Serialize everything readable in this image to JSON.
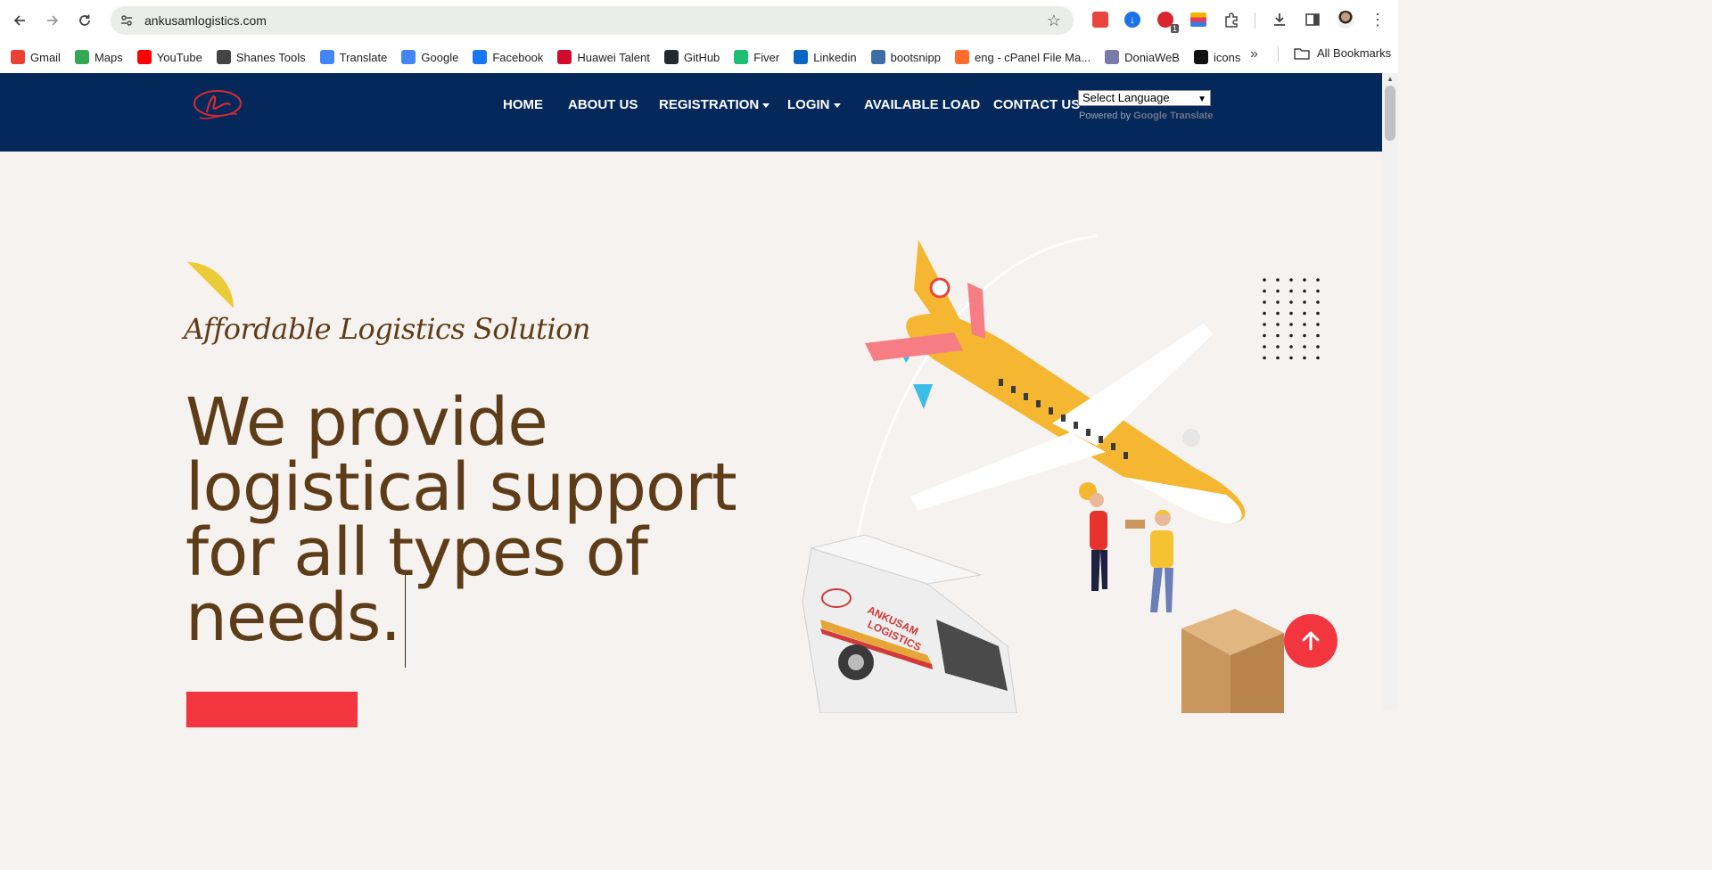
{
  "browser": {
    "url": "ankusamlogistics.com",
    "extension_badge": "1",
    "bookmarks": [
      {
        "label": "Gmail",
        "icon": "gmail-icon",
        "color": "#ea4335"
      },
      {
        "label": "Maps",
        "icon": "maps-icon",
        "color": "#34a853"
      },
      {
        "label": "YouTube",
        "icon": "youtube-icon",
        "color": "#ff0000"
      },
      {
        "label": "Shanes Tools",
        "icon": "globe-icon",
        "color": "#444444"
      },
      {
        "label": "Translate",
        "icon": "translate-icon",
        "color": "#4285f4"
      },
      {
        "label": "Google",
        "icon": "google-icon",
        "color": "#4285f4"
      },
      {
        "label": "Facebook",
        "icon": "facebook-icon",
        "color": "#1877f2"
      },
      {
        "label": "Huawei Talent",
        "icon": "huawei-icon",
        "color": "#cf0a2c"
      },
      {
        "label": "GitHub",
        "icon": "github-icon",
        "color": "#24292e"
      },
      {
        "label": "Fiver",
        "icon": "fiverr-icon",
        "color": "#1dbf73"
      },
      {
        "label": "Linkedin",
        "icon": "linkedin-icon",
        "color": "#0a66c2"
      },
      {
        "label": "bootsnipp",
        "icon": "bootsnipp-icon",
        "color": "#3a6ea5"
      },
      {
        "label": "eng - cPanel File Ma...",
        "icon": "cpanel-icon",
        "color": "#ff6c2c"
      },
      {
        "label": "DoniaWeB",
        "icon": "doniaweb-icon",
        "color": "#7a7aa8"
      },
      {
        "label": "icons",
        "icon": "icons-icon",
        "color": "#111111"
      }
    ],
    "all_bookmarks": "All Bookmarks"
  },
  "site": {
    "nav": [
      {
        "label": "HOME",
        "dropdown": false
      },
      {
        "label": "ABOUT US",
        "dropdown": false
      },
      {
        "label": "REGISTRATION",
        "dropdown": true
      },
      {
        "label": "LOGIN",
        "dropdown": true
      },
      {
        "label": "AVAILABLE LOAD",
        "dropdown": false
      },
      {
        "label": "CONTACT US",
        "dropdown": false
      }
    ],
    "language_select": "Select Language",
    "powered_by": "Powered by",
    "google_translate": "Google Translate",
    "colors": {
      "header": "#04285a",
      "accent": "#f2353e",
      "headline": "#5d3c18",
      "background": "#f6f2ef"
    }
  },
  "hero": {
    "tagline": "Affordable Logistics Solution",
    "title_lines": [
      "We provide",
      "logistical support",
      "for all types of",
      "needs."
    ],
    "van_text_1": "ANKUSAM",
    "van_text_2": "LOGISTICS"
  }
}
